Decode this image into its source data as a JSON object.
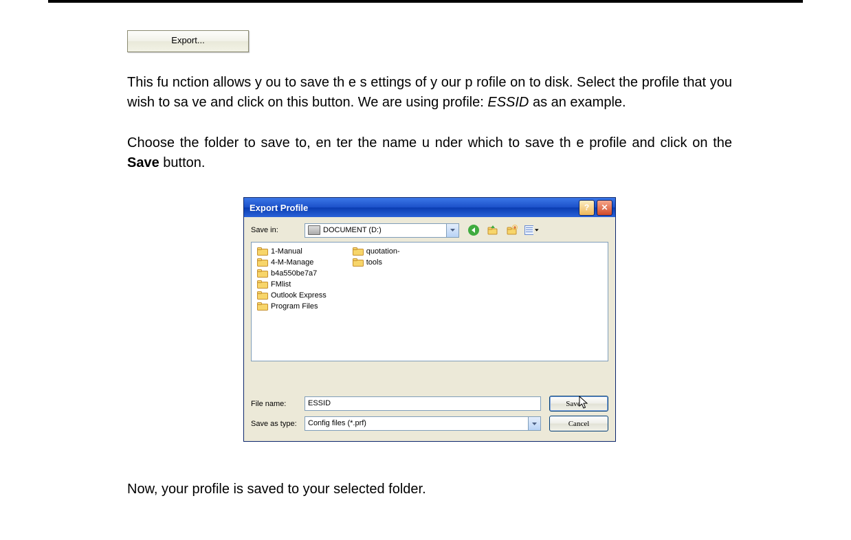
{
  "export_button_label": "Export...",
  "paragraph1_a": "This fu nction  allows y ou to save th   e s ettings of y  our p rofile on to disk.  Select the  profile that you wish to sa ve and click on this button.   We are using profile: ",
  "paragraph1_italic": "ESSID",
  "paragraph1_b": " as an example.",
  "paragraph2_a": "Choose the folder to save to, en ter the name u nder which to save th e profile and click on the ",
  "paragraph2_bold": "Save",
  "paragraph2_b": " button.",
  "dialog": {
    "title": "Export Profile",
    "help_btn": "?",
    "close_btn": "✕",
    "save_in_label": "Save in:",
    "save_in_value": "DOCUMENT (D:)",
    "folders_col1": [
      "1-Manual",
      "4-M-Manage",
      "b4a550be7a7",
      "FMlist",
      "Outlook Express",
      "Program Files"
    ],
    "folders_col2": [
      "quotation-",
      "tools"
    ],
    "file_name_label": "File name:",
    "file_name_value": "ESSID",
    "save_as_type_label": "Save as type:",
    "save_as_type_value": "Config files (*.prf)",
    "save_btn": "Save",
    "cancel_btn": "Cancel"
  },
  "paragraph3": "Now, your profile is saved to your selected folder."
}
